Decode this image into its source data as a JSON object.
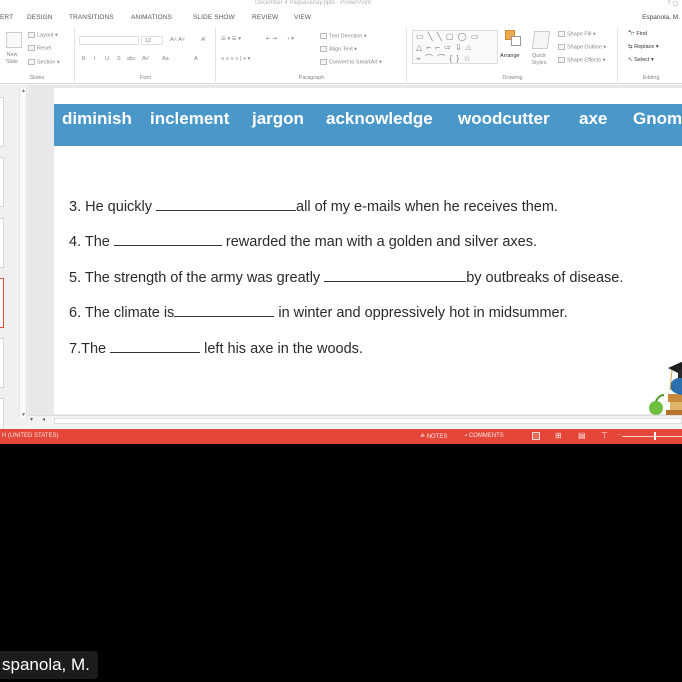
{
  "window": {
    "title": "December 4 Pagsasanay.pptx - PowerPoint",
    "user": "Espanola, M."
  },
  "ribbon": {
    "tabs": [
      "ERT",
      "DESIGN",
      "TRANSITIONS",
      "ANIMATIONS",
      "SLIDE SHOW",
      "REVIEW",
      "VIEW"
    ],
    "slides_group": {
      "new_slide": "New Slide",
      "layout": "Layout",
      "reset": "Reset",
      "section": "Section",
      "label": "Slides"
    },
    "font_group": {
      "font_size": "12",
      "label": "Font",
      "buttons": [
        "B",
        "I",
        "U",
        "S",
        "abc",
        "AV",
        "Aa",
        "A"
      ]
    },
    "paragraph_group": {
      "text_direction": "Text Direction",
      "align_text": "Align Text",
      "convert_smartart": "Convert to SmartArt",
      "label": "Paragraph"
    },
    "drawing_group": {
      "shapes_rows": [
        "▭ ╲ ╲ ▢ ◯ ▭",
        "△ ⌐ ⌐ ⇨ ⇩ ⌂",
        "⌁ ⌒ ⌒ { } ☆"
      ],
      "arrange": "Arrange",
      "quick_styles": "Quick Styles",
      "shape_fill": "Shape Fill",
      "shape_outline": "Shape Outline",
      "shape_effects": "Shape Effects",
      "label": "Drawing"
    },
    "editing_group": {
      "find": "Find",
      "replace": "Replace",
      "select": "Select",
      "label": "Editing"
    }
  },
  "slide": {
    "word_bank": [
      "diminish",
      "inclement",
      "jargon",
      "acknowledge",
      "woodcutter",
      "axe",
      "Gnom"
    ],
    "word_bank_color": "#4a97c9",
    "questions": [
      {
        "before": "3. He quickly ",
        "after": "all of my e-mails when he receives them."
      },
      {
        "before": "4. The ",
        "after": " rewarded the man with a golden and silver axes."
      },
      {
        "before": "5. The strength of the army was greatly ",
        "after": "by outbreaks of disease."
      },
      {
        "before": "6. The climate is",
        "after": " in winter and oppressively hot in midsummer."
      },
      {
        "before": "7.The ",
        "after": " left his axe in the woods."
      }
    ]
  },
  "statusbar": {
    "language": "H (UNITED STATES)",
    "notes": "NOTES",
    "comments": "COMMENTS",
    "color": "#e4473a"
  },
  "video_overlay": {
    "participant_name": "spanola, M."
  }
}
